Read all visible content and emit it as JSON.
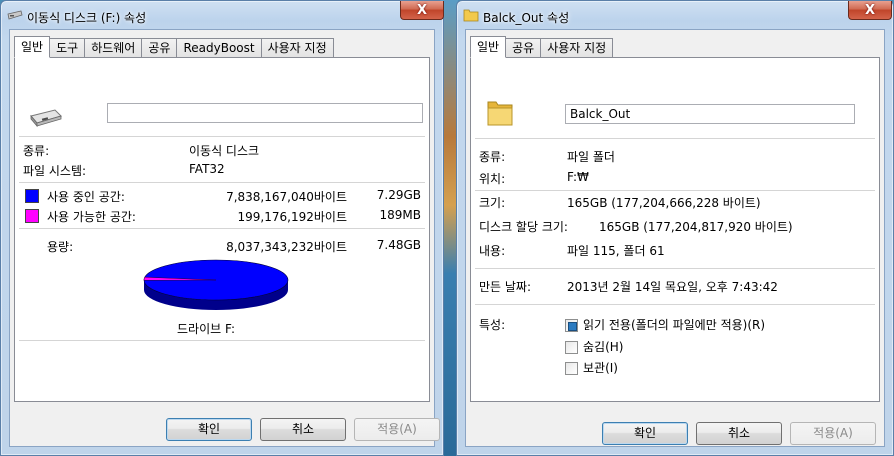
{
  "left_window": {
    "title": "이동식 디스크 (F:) 속성",
    "close_label": "X",
    "tabs": [
      "일반",
      "도구",
      "하드웨어",
      "공유",
      "ReadyBoost",
      "사용자 지정"
    ],
    "active_tab": "일반",
    "name_value": "",
    "type_label": "종류:",
    "type_value": "이동식 디스크",
    "fs_label": "파일 시스템:",
    "fs_value": "FAT32",
    "used_label": "사용 중인 공간:",
    "used_bytes": "7,838,167,040바이트",
    "used_size": "7.29GB",
    "free_label": "사용 가능한 공간:",
    "free_bytes": "199,176,192바이트",
    "free_size": "189MB",
    "capacity_label": "용량:",
    "capacity_bytes": "8,037,343,232바이트",
    "capacity_size": "7.48GB",
    "drive_label": "드라이브 F:",
    "used_color": "#0000ff",
    "free_color": "#ff00ff",
    "used_fraction": 0.9752,
    "buttons": {
      "ok": "확인",
      "cancel": "취소",
      "apply": "적용(A)"
    }
  },
  "right_window": {
    "title": "Balck_Out 속성",
    "close_label": "X",
    "tabs": [
      "일반",
      "공유",
      "사용자 지정"
    ],
    "active_tab": "일반",
    "name_value": "Balck_Out",
    "type_label": "종류:",
    "type_value": "파일 폴더",
    "location_label": "위치:",
    "location_value": "F:₩",
    "size_label": "크기:",
    "size_value": "165GB (177,204,666,228 바이트)",
    "disk_size_label": "디스크 할당 크기:",
    "disk_size_value": "165GB (177,204,817,920 바이트)",
    "contains_label": "내용:",
    "contains_value": "파일 115, 폴더 61",
    "created_label": "만든 날짜:",
    "created_value": "2013년 2월 14일 목요일, 오후 7:43:42",
    "attributes_label": "특성:",
    "attr_readonly": "읽기 전용(폴더의 파일에만 적용)(R)",
    "attr_readonly_checked": true,
    "attr_hidden": "숨김(H)",
    "attr_hidden_checked": false,
    "attr_archive": "보관(I)",
    "attr_archive_checked": false,
    "buttons": {
      "ok": "확인",
      "cancel": "취소",
      "apply": "적용(A)"
    }
  }
}
